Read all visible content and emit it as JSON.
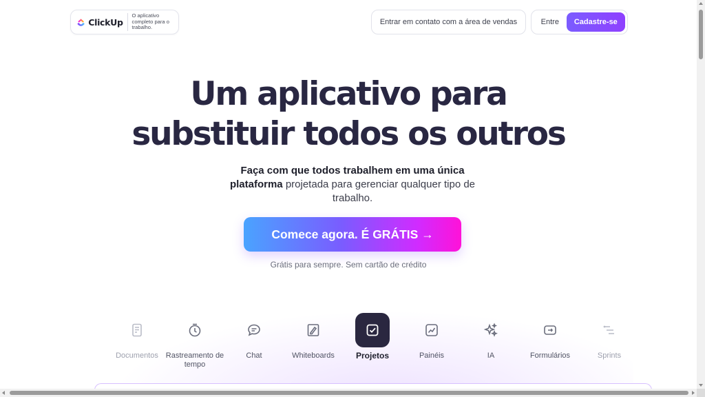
{
  "header": {
    "logo_text": "ClickUp",
    "tagline": "O aplicativo completo para o trabalho.",
    "contact_sales": "Entrar em contato com a área de vendas",
    "login": "Entre",
    "signup": "Cadastre-se"
  },
  "hero": {
    "title_line1": "Um aplicativo para",
    "title_line2": "substituir todos os outros",
    "subtitle_bold": "Faça com que todos trabalhem em uma única plataforma",
    "subtitle_rest": " projetada para gerenciar qualquer tipo de trabalho.",
    "cta": "Comece agora. É GRÁTIS →",
    "cta_note": "Grátis para sempre. Sem cartão de crédito"
  },
  "features": [
    {
      "label": "Documentos",
      "icon": "document-icon",
      "state": "faded"
    },
    {
      "label": "Rastreamento de tempo",
      "icon": "clock-icon",
      "state": "normal"
    },
    {
      "label": "Chat",
      "icon": "chat-icon",
      "state": "normal"
    },
    {
      "label": "Whiteboards",
      "icon": "whiteboard-icon",
      "state": "normal"
    },
    {
      "label": "Projetos",
      "icon": "checkbox-icon",
      "state": "active"
    },
    {
      "label": "Painéis",
      "icon": "dashboard-icon",
      "state": "normal"
    },
    {
      "label": "IA",
      "icon": "sparkle-icon",
      "state": "normal"
    },
    {
      "label": "Formulários",
      "icon": "form-icon",
      "state": "normal"
    },
    {
      "label": "Sprints",
      "icon": "sprint-icon",
      "state": "faded"
    }
  ],
  "colors": {
    "title": "#292742",
    "brand_purple": "#7b5cff",
    "brand_pink": "#ff12d8",
    "active_tab_bg": "#2a2740"
  }
}
